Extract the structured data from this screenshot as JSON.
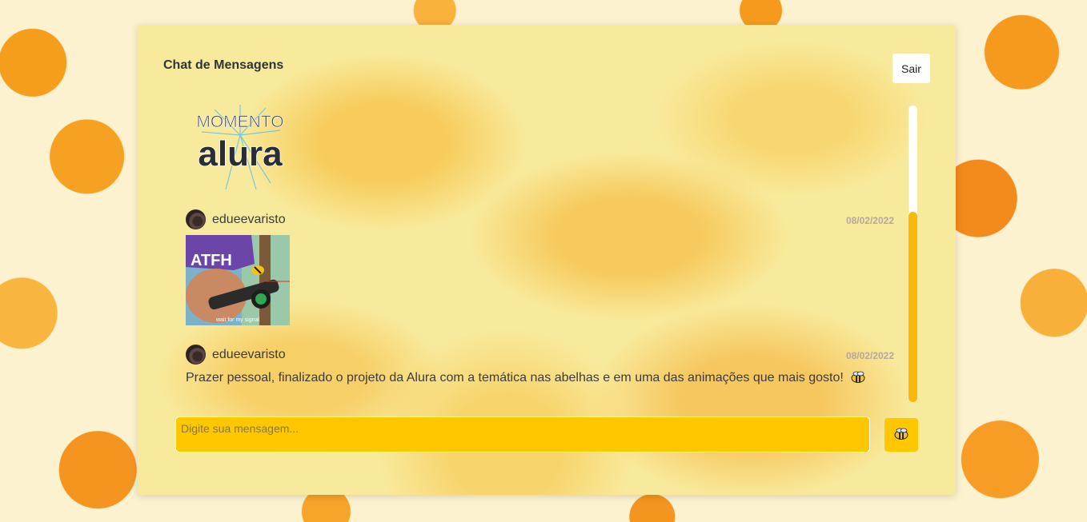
{
  "header": {
    "title": "Chat de Mensagens",
    "logout_label": "Sair"
  },
  "messages": [
    {
      "type": "sticker",
      "logo_text_top": "MOMENTO",
      "logo_text_bottom": "alura"
    },
    {
      "type": "sticker",
      "username": "edueevaristo",
      "date": "08/02/2022",
      "sticker_caption_top": "ATFH",
      "sticker_caption_bottom": "wait for my signal"
    },
    {
      "type": "text",
      "username": "edueevaristo",
      "date": "08/02/2022",
      "text": "Prazer pessoal, finalizado o projeto da Alura com a temática nas abelhas e em uma das animações que mais gosto!",
      "emoji": "bee-icon"
    }
  ],
  "composer": {
    "placeholder": "Digite sua mensagem...",
    "send_icon": "bee-icon"
  },
  "colors": {
    "accent": "#fec700",
    "scroll_thumb": "#f8b90c",
    "panel": "#f8ea9c",
    "date": "#b5a79a"
  }
}
